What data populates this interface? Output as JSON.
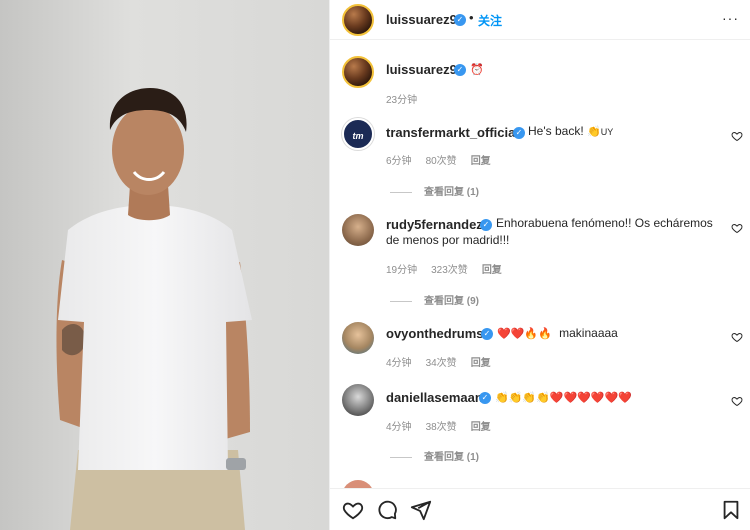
{
  "post": {
    "author": "luissuarez9",
    "follow_label": "关注",
    "more_icon": "more-horizontal-icon"
  },
  "caption": {
    "author": "luissuarez9",
    "emoji": "⏰",
    "time": "23分钟"
  },
  "comments": [
    {
      "user": "transfermarkt_official",
      "text": "He's back!",
      "emoji": "👏",
      "emoji_suffix": "UY",
      "time": "6分钟",
      "likes": "80次赞",
      "reply": "回复",
      "view_replies": "查看回复 (1)"
    },
    {
      "user": "rudy5fernandez",
      "text": "Enhorabuena fenómeno!! Os echáremos de menos por madrid!!!",
      "time": "19分钟",
      "likes": "323次赞",
      "reply": "回复",
      "view_replies": "查看回复 (9)"
    },
    {
      "user": "ovyonthedrums",
      "emoji": "❤️❤️🔥🔥",
      "text": "makinaaaa",
      "time": "4分钟",
      "likes": "34次赞",
      "reply": "回复"
    },
    {
      "user": "daniellasemaan",
      "emoji_claps": "👏👏👏👏",
      "emoji_hearts": "❤️❤️❤️❤️❤️❤️",
      "time": "4分钟",
      "likes": "38次赞",
      "reply": "回复",
      "view_replies": "查看回复 (1)"
    }
  ],
  "actions": {
    "like": "heart-icon",
    "comment": "comment-icon",
    "share": "send-icon",
    "save": "bookmark-icon"
  }
}
